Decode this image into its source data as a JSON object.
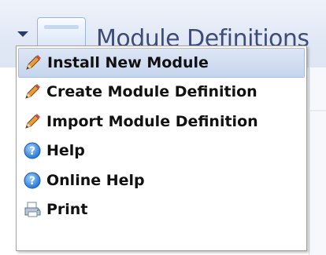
{
  "header": {
    "title": "Module Definitions"
  },
  "menu": {
    "items": [
      {
        "label": "Install New Module",
        "icon": "pencil-icon",
        "highlighted": true
      },
      {
        "label": "Create Module Definition",
        "icon": "pencil-icon",
        "highlighted": false
      },
      {
        "label": "Import Module Definition",
        "icon": "pencil-icon",
        "highlighted": false
      },
      {
        "label": "Help",
        "icon": "help-icon",
        "highlighted": false
      },
      {
        "label": "Online Help",
        "icon": "help-icon",
        "highlighted": false
      },
      {
        "label": "Print",
        "icon": "printer-icon",
        "highlighted": false
      }
    ]
  },
  "colors": {
    "highlight": "#c6d5ee",
    "title": "#3d4d78",
    "help_icon": "#2f7ad8"
  }
}
